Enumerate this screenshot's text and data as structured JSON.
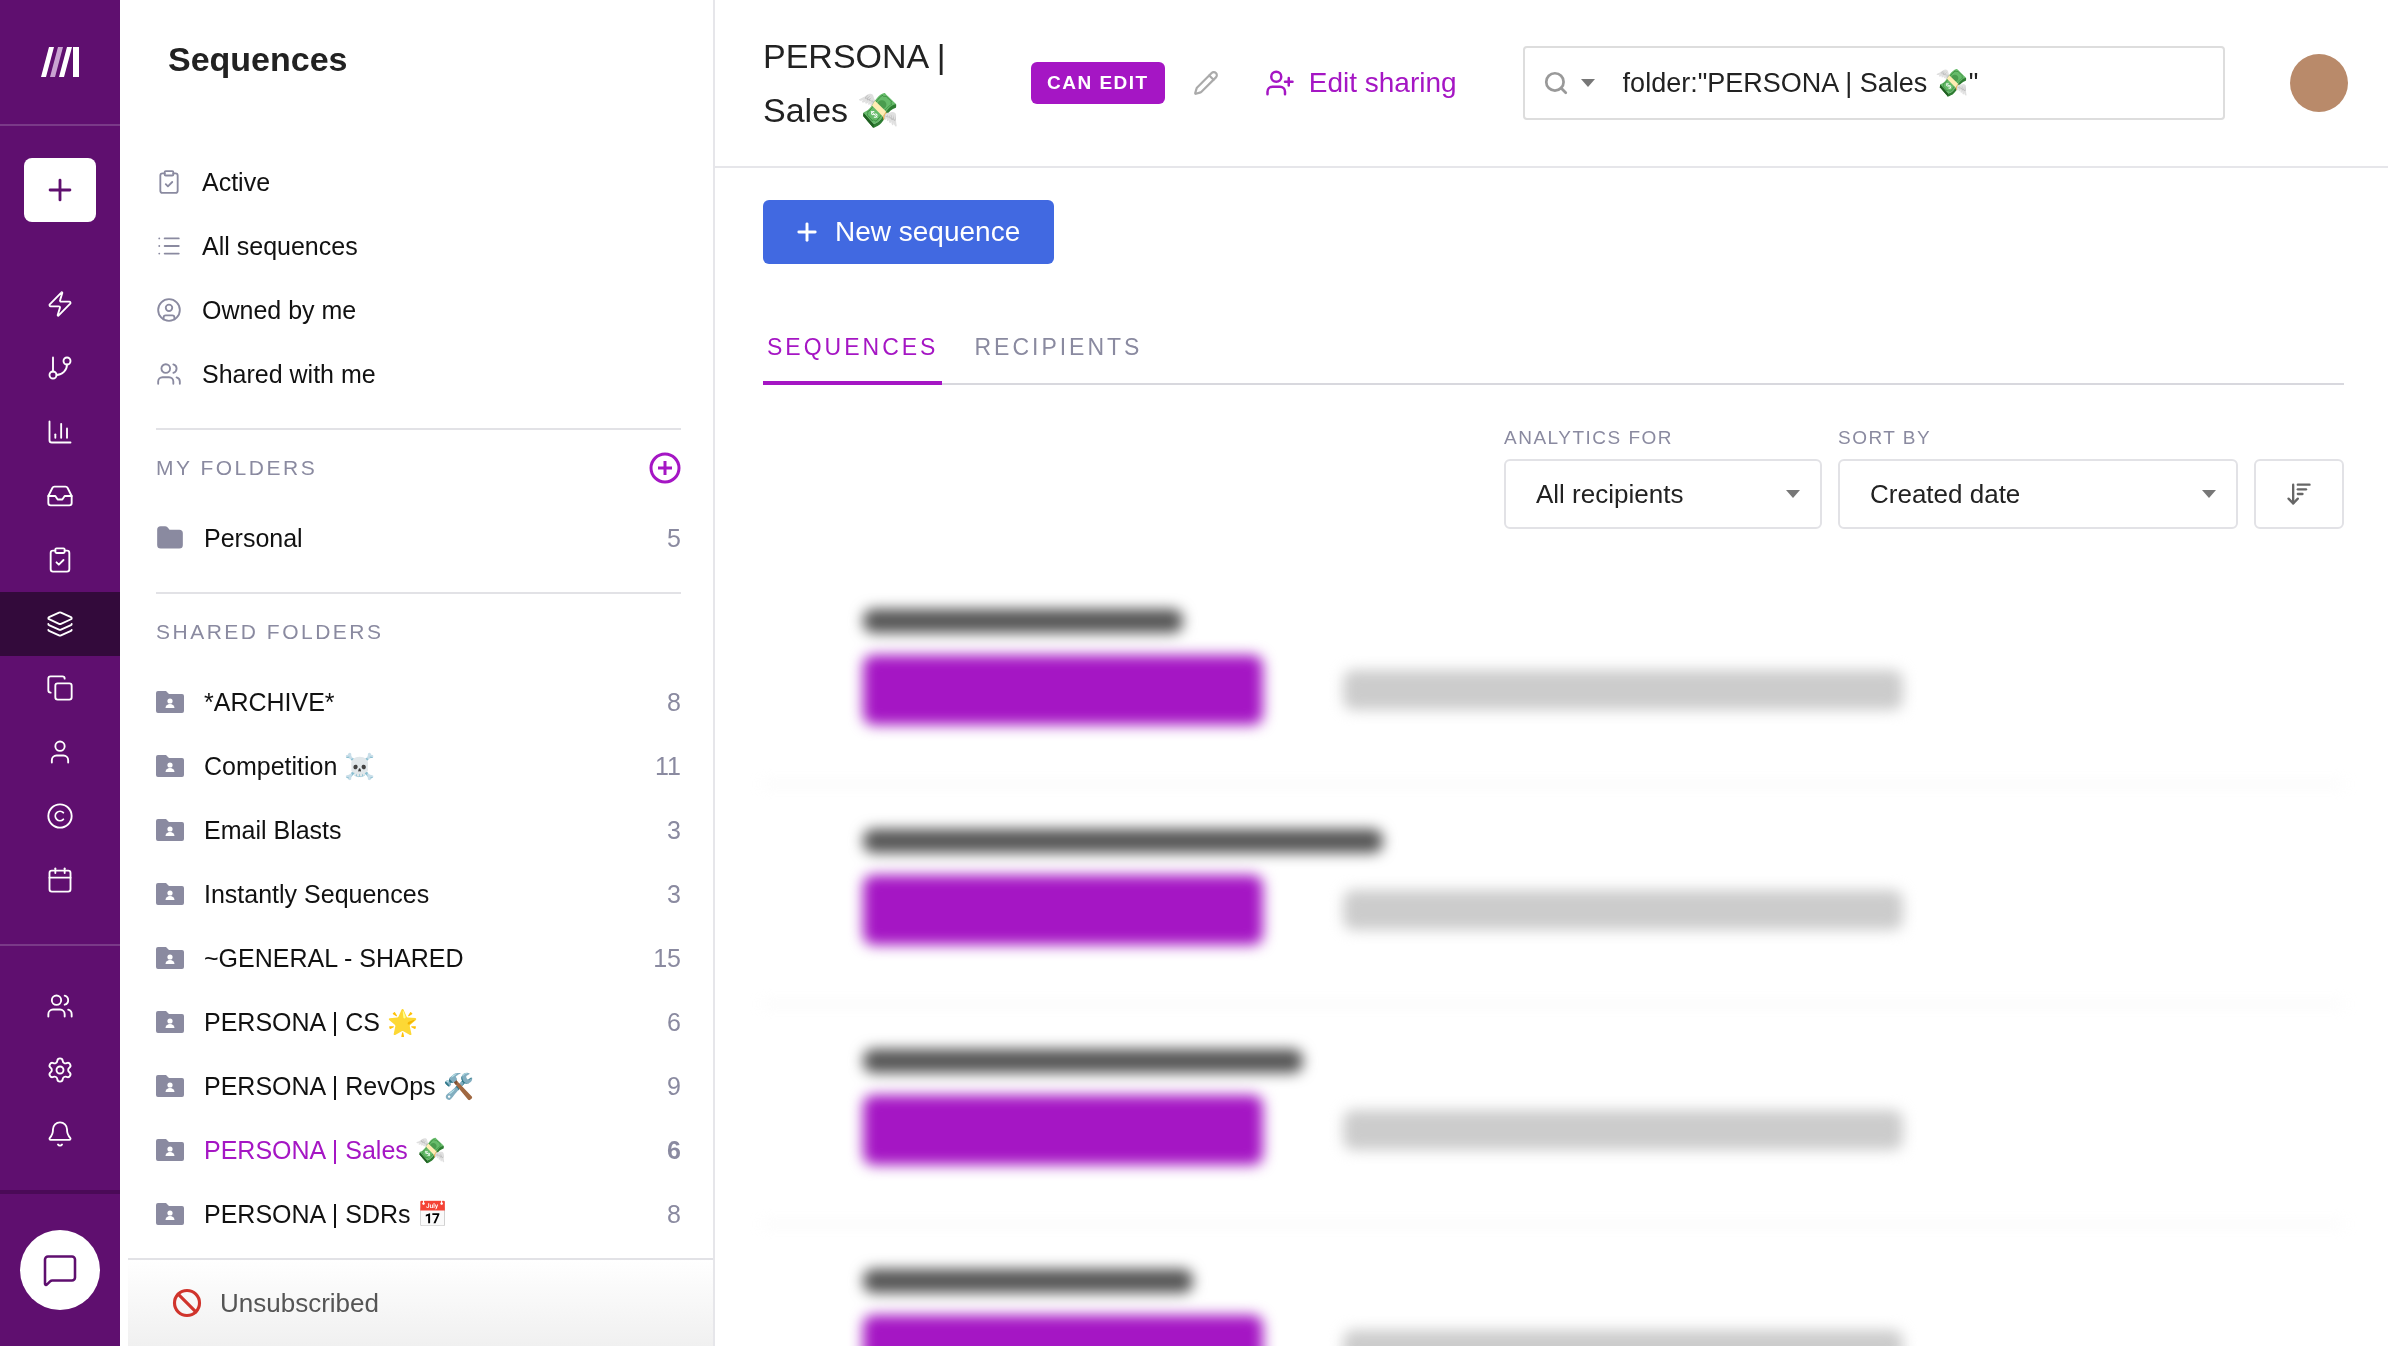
{
  "nav_rail": {
    "top": [
      {
        "selected": false
      },
      {
        "selected": false
      },
      {
        "selected": false
      },
      {
        "selected": false
      },
      {
        "selected": false
      },
      {
        "selected": true
      },
      {
        "selected": false
      },
      {
        "selected": false
      },
      {
        "selected": false
      },
      {
        "selected": false
      }
    ],
    "bottom": [
      {
        "selected": false
      },
      {
        "selected": false
      },
      {
        "selected": false
      }
    ]
  },
  "sidebar": {
    "title": "Sequences",
    "views": [
      {
        "label": "Active",
        "selected": false
      },
      {
        "label": "All sequences",
        "selected": false
      },
      {
        "label": "Owned by me",
        "selected": false
      },
      {
        "label": "Shared with me",
        "selected": false
      }
    ],
    "my_folders": {
      "heading": "MY FOLDERS",
      "items": [
        {
          "label": "Personal",
          "count": "5",
          "selected": false
        }
      ]
    },
    "shared_folders": {
      "heading": "SHARED FOLDERS",
      "items": [
        {
          "label": "*ARCHIVE*",
          "count": "8",
          "selected": false
        },
        {
          "label": "Competition ☠️",
          "count": "11",
          "selected": false
        },
        {
          "label": "Email Blasts",
          "count": "3",
          "selected": false
        },
        {
          "label": "Instantly Sequences",
          "count": "3",
          "selected": false
        },
        {
          "label": "~GENERAL - SHARED",
          "count": "15",
          "selected": false
        },
        {
          "label": "PERSONA | CS 🌟",
          "count": "6",
          "selected": false
        },
        {
          "label": "PERSONA | RevOps 🛠️",
          "count": "9",
          "selected": false
        },
        {
          "label": "PERSONA | Sales 💸",
          "count": "6",
          "selected": true
        },
        {
          "label": "PERSONA | SDRs 📅",
          "count": "8",
          "selected": false
        }
      ]
    },
    "footer": {
      "label": "Unsubscribed"
    }
  },
  "header": {
    "title": "PERSONA | Sales 💸",
    "badge": "CAN EDIT",
    "share_link": "Edit sharing",
    "search": {
      "value": "folder:\"PERSONA | Sales 💸\""
    }
  },
  "new_button": "New sequence",
  "tabs": [
    {
      "label": "SEQUENCES",
      "selected": true
    },
    {
      "label": "RECIPIENTS",
      "selected": false
    }
  ],
  "filters": [
    {
      "label": "ANALYTICS FOR",
      "value": "All recipients"
    },
    {
      "label": "SORT BY",
      "value": "Created date"
    }
  ]
}
